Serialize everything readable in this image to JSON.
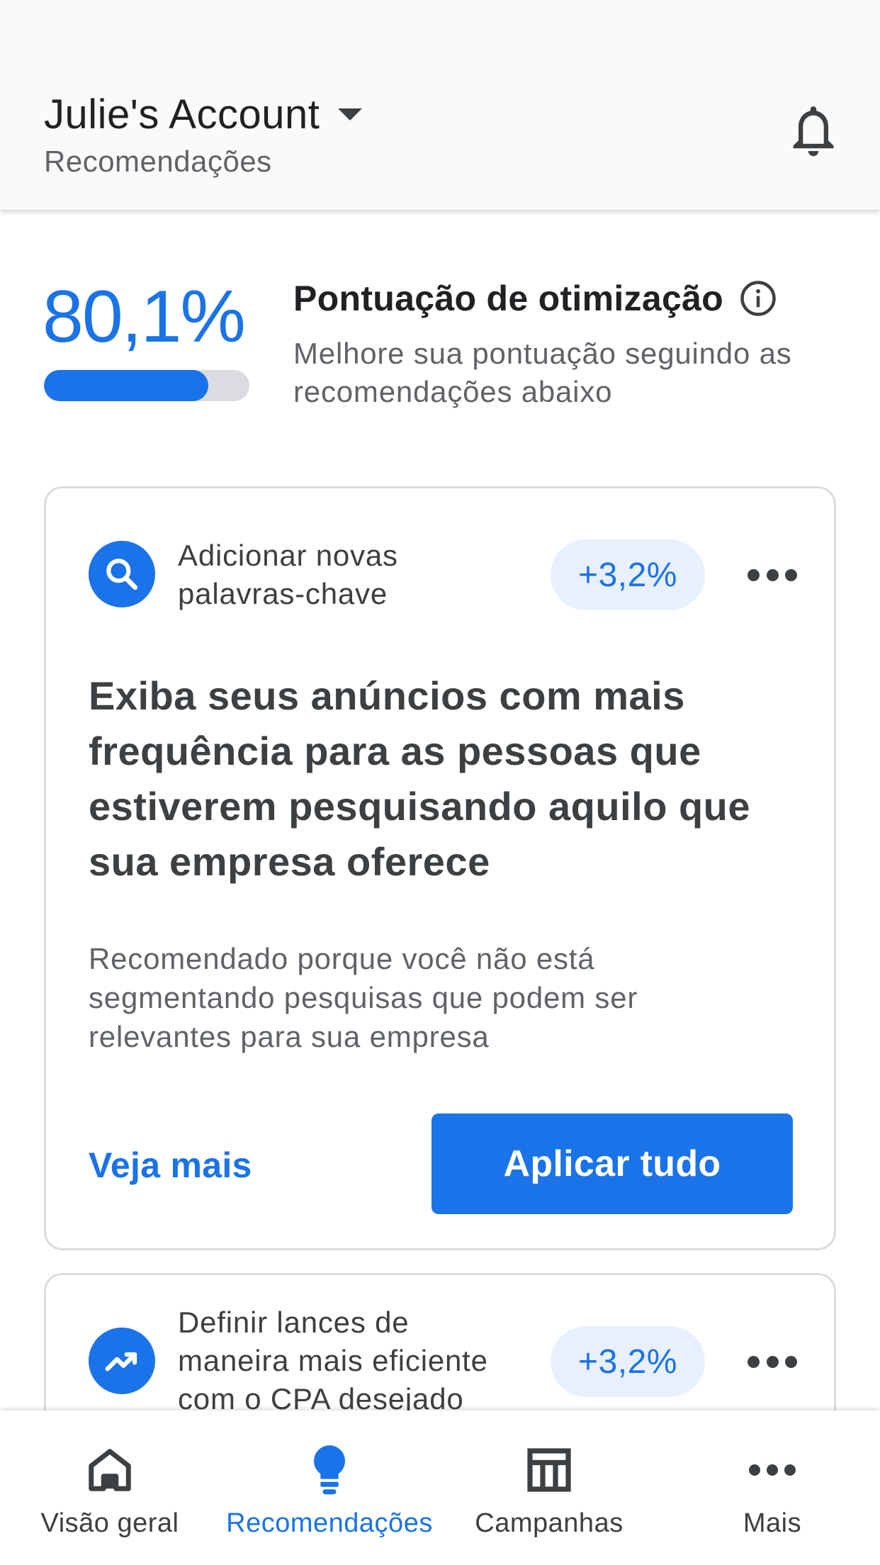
{
  "header": {
    "account_title": "Julie's Account",
    "subtitle": "Recomendações"
  },
  "score": {
    "value_text": "80,1%",
    "progress_percent": 80.1,
    "title": "Pontuação de otimização",
    "description": "Melhore sua pontuação seguindo as recomendações abaixo"
  },
  "cards": [
    {
      "category_line1": "Adicionar novas",
      "category_line2": "palavras-chave",
      "category_icon": "search-icon",
      "uplift": "+3,2%",
      "headline": "Exiba seus anúncios com mais frequência para as pessoas que estiverem pesquisando aquilo que sua empresa oferece",
      "reason": "Recomendado porque você não está segmentando pesquisas que podem ser relevantes para sua empresa",
      "see_more_label": "Veja mais",
      "apply_label": "Aplicar tudo"
    },
    {
      "category_line1": "Definir lances de",
      "category_line2": "maneira mais eficiente",
      "category_line3": "com o CPA desejado",
      "category_icon": "trending-up-icon",
      "uplift": "+3,2%"
    }
  ],
  "bottom_nav": [
    {
      "label": "Visão geral",
      "icon": "home-icon"
    },
    {
      "label": "Recomendações",
      "icon": "lightbulb-icon",
      "active": true
    },
    {
      "label": "Campanhas",
      "icon": "table-icon"
    },
    {
      "label": "Mais",
      "icon": "more-horizontal-icon"
    }
  ],
  "colors": {
    "accent": "#1a73e8",
    "pill_bg": "#e8f0fe",
    "text_dark": "#202124",
    "text_body": "#3c4043",
    "text_muted": "#5f6368"
  }
}
